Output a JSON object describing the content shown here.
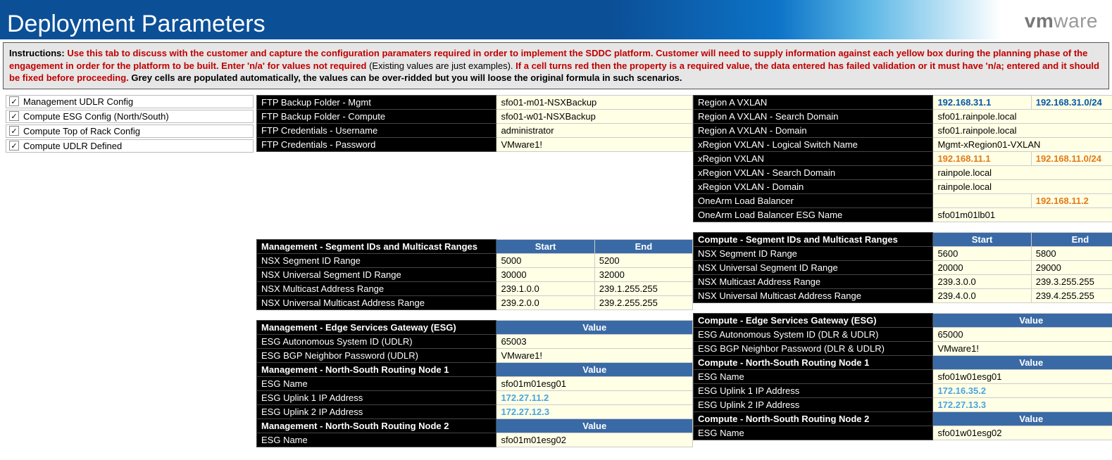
{
  "banner": {
    "title": "Deployment Parameters",
    "logo1": "vm",
    "logo2": "ware"
  },
  "instructions": {
    "label": "Instructions:",
    "red1": " Use this tab to discuss with the customer and capture the configuration paramaters required in order to implement the SDDC platform. Customer will need to supply information against each yellow box during the planning phase of the engagement in order for the platform to be built. Enter 'n/a' for values not required ",
    "black1": "(Existing values are just examples). ",
    "red2": "If a cell turns red then the property is a required value, the data entered has failed validation or it must have 'n/a; entered and it should be fixed before proceeding. ",
    "bold2": "Grey cells are populated automatically, the values can be over-ridded but you will loose the original formula in such scenarios."
  },
  "checks": [
    "Management UDLR Config",
    "Compute ESG Config (North/South)",
    "Compute Top of Rack Config",
    "Compute UDLR Defined"
  ],
  "mgmt_ftp": {
    "rows": [
      [
        "FTP Backup Folder - Mgmt",
        "sfo01-m01-NSXBackup"
      ],
      [
        "FTP Backup Folder - Compute",
        "sfo01-w01-NSXBackup"
      ],
      [
        "FTP Credentials - Username",
        "administrator"
      ],
      [
        "FTP Credentials - Password",
        "VMware1!"
      ]
    ]
  },
  "right_vxlan": {
    "rows": [
      {
        "l": "Region A VXLAN",
        "v1": "192.168.31.1",
        "v2": "192.168.31.0/24",
        "cls": "val-blue"
      },
      {
        "l": "Region A VXLAN - Search Domain",
        "v1": "sfo01.rainpole.local",
        "cls": "val",
        "span": 2
      },
      {
        "l": "Region A VXLAN - Domain",
        "v1": "sfo01.rainpole.local",
        "cls": "val",
        "span": 2
      },
      {
        "l": "xRegion VXLAN - Logical Switch Name",
        "v1": "Mgmt-xRegion01-VXLAN",
        "cls": "val",
        "span": 2
      },
      {
        "l": "xRegion VXLAN",
        "v1": "192.168.11.1",
        "v2": "192.168.11.0/24",
        "cls": "val-orange"
      },
      {
        "l": "xRegion VXLAN - Search Domain",
        "v1": "rainpole.local",
        "cls": "val",
        "span": 2
      },
      {
        "l": "xRegion VXLAN - Domain",
        "v1": "rainpole.local",
        "cls": "val",
        "span": 2
      },
      {
        "l": "OneArm Load Balancer",
        "v1": "",
        "v2": "192.168.11.2",
        "cls": "val-orange"
      },
      {
        "l": "OneArm Load Balancer ESG Name",
        "v1": "sfo01m01lb01",
        "cls": "val",
        "span": 2
      }
    ]
  },
  "mgmt_seg": {
    "title": "Management - Segment IDs and Multicast Ranges",
    "h1": "Start",
    "h2": "End",
    "rows": [
      [
        "NSX Segment ID Range",
        "5000",
        "5200"
      ],
      [
        "NSX Universal Segment ID Range",
        "30000",
        "32000"
      ],
      [
        "NSX Multicast Address Range",
        "239.1.0.0",
        "239.1.255.255"
      ],
      [
        "NSX Universal Multicast Address Range",
        "239.2.0.0",
        "239.2.255.255"
      ]
    ]
  },
  "comp_seg": {
    "title": "Compute - Segment IDs and Multicast Ranges",
    "h1": "Start",
    "h2": "End",
    "rows": [
      [
        "NSX Segment ID Range",
        "5600",
        "5800"
      ],
      [
        "NSX Universal Segment ID Range",
        "20000",
        "29000"
      ],
      [
        "NSX Multicast Address Range",
        "239.3.0.0",
        "239.3.255.255"
      ],
      [
        "NSX Universal Multicast Address Range",
        "239.4.0.0",
        "239.4.255.255"
      ]
    ]
  },
  "mgmt_esg": {
    "t1": "Management  - Edge Services Gateway (ESG)",
    "hv": "Value",
    "r1": [
      "ESG Autonomous System ID (UDLR)",
      "65003"
    ],
    "r2": [
      "ESG BGP Neighbor Password (UDLR)",
      "VMware1!"
    ],
    "t2": "Management  - North-South Routing Node 1",
    "r3": [
      "ESG Name",
      "sfo01m01esg01"
    ],
    "r4": [
      "ESG Uplink 1 IP Address",
      "172.27.11.2"
    ],
    "r5": [
      "ESG Uplink 2 IP Address",
      "172.27.12.3"
    ],
    "t3": "Management  - North-South Routing Node 2",
    "r6": [
      "ESG Name",
      "sfo01m01esg02"
    ]
  },
  "comp_esg": {
    "t1": "Compute - Edge Services Gateway (ESG)",
    "hv": "Value",
    "r1": [
      "ESG Autonomous System ID (DLR & UDLR)",
      "65000"
    ],
    "r2": [
      "ESG BGP Neighbor Password (DLR & UDLR)",
      "VMware1!"
    ],
    "t2": "Compute  - North-South Routing Node 1",
    "r3": [
      "ESG Name",
      "sfo01w01esg01"
    ],
    "r4": [
      "ESG Uplink 1 IP Address",
      "172.16.35.2"
    ],
    "r5": [
      "ESG Uplink 2 IP Address",
      "172.27.13.3"
    ],
    "t3": "Compute - North-South Routing Node 2",
    "r6": [
      "ESG Name",
      "sfo01w01esg02"
    ]
  }
}
